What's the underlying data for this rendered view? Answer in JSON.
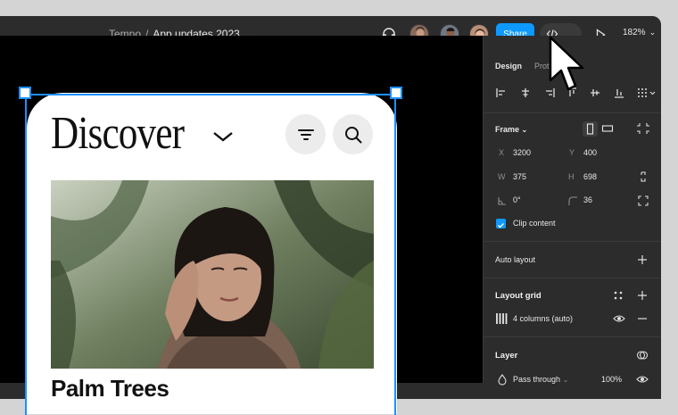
{
  "topbar": {
    "breadcrumb_project": "Tempo",
    "breadcrumb_sep": "/",
    "breadcrumb_file": "App updates 2023",
    "share_label": "Share",
    "zoom_label": "182%"
  },
  "canvas": {
    "title": "Discover",
    "card_title": "Palm Trees"
  },
  "panel": {
    "tab_design": "Design",
    "tab_prototype": "Prot",
    "frame_label": "Frame",
    "x_label": "X",
    "x_value": "3200",
    "y_label": "Y",
    "y_value": "400",
    "w_label": "W",
    "w_value": "375",
    "h_label": "H",
    "h_value": "698",
    "rotation_value": "0°",
    "radius_value": "36",
    "clip_content_label": "Clip content",
    "auto_layout_label": "Auto layout",
    "layout_grid_label": "Layout grid",
    "grid_item_label": "4 columns (auto)",
    "layer_label": "Layer",
    "blend_mode_label": "Pass through",
    "opacity_value": "100%"
  },
  "colors": {
    "accent": "#0d99ff",
    "selection": "#1e8fff",
    "panel_bg": "#2c2c2c",
    "canvas_bg": "#000000"
  }
}
